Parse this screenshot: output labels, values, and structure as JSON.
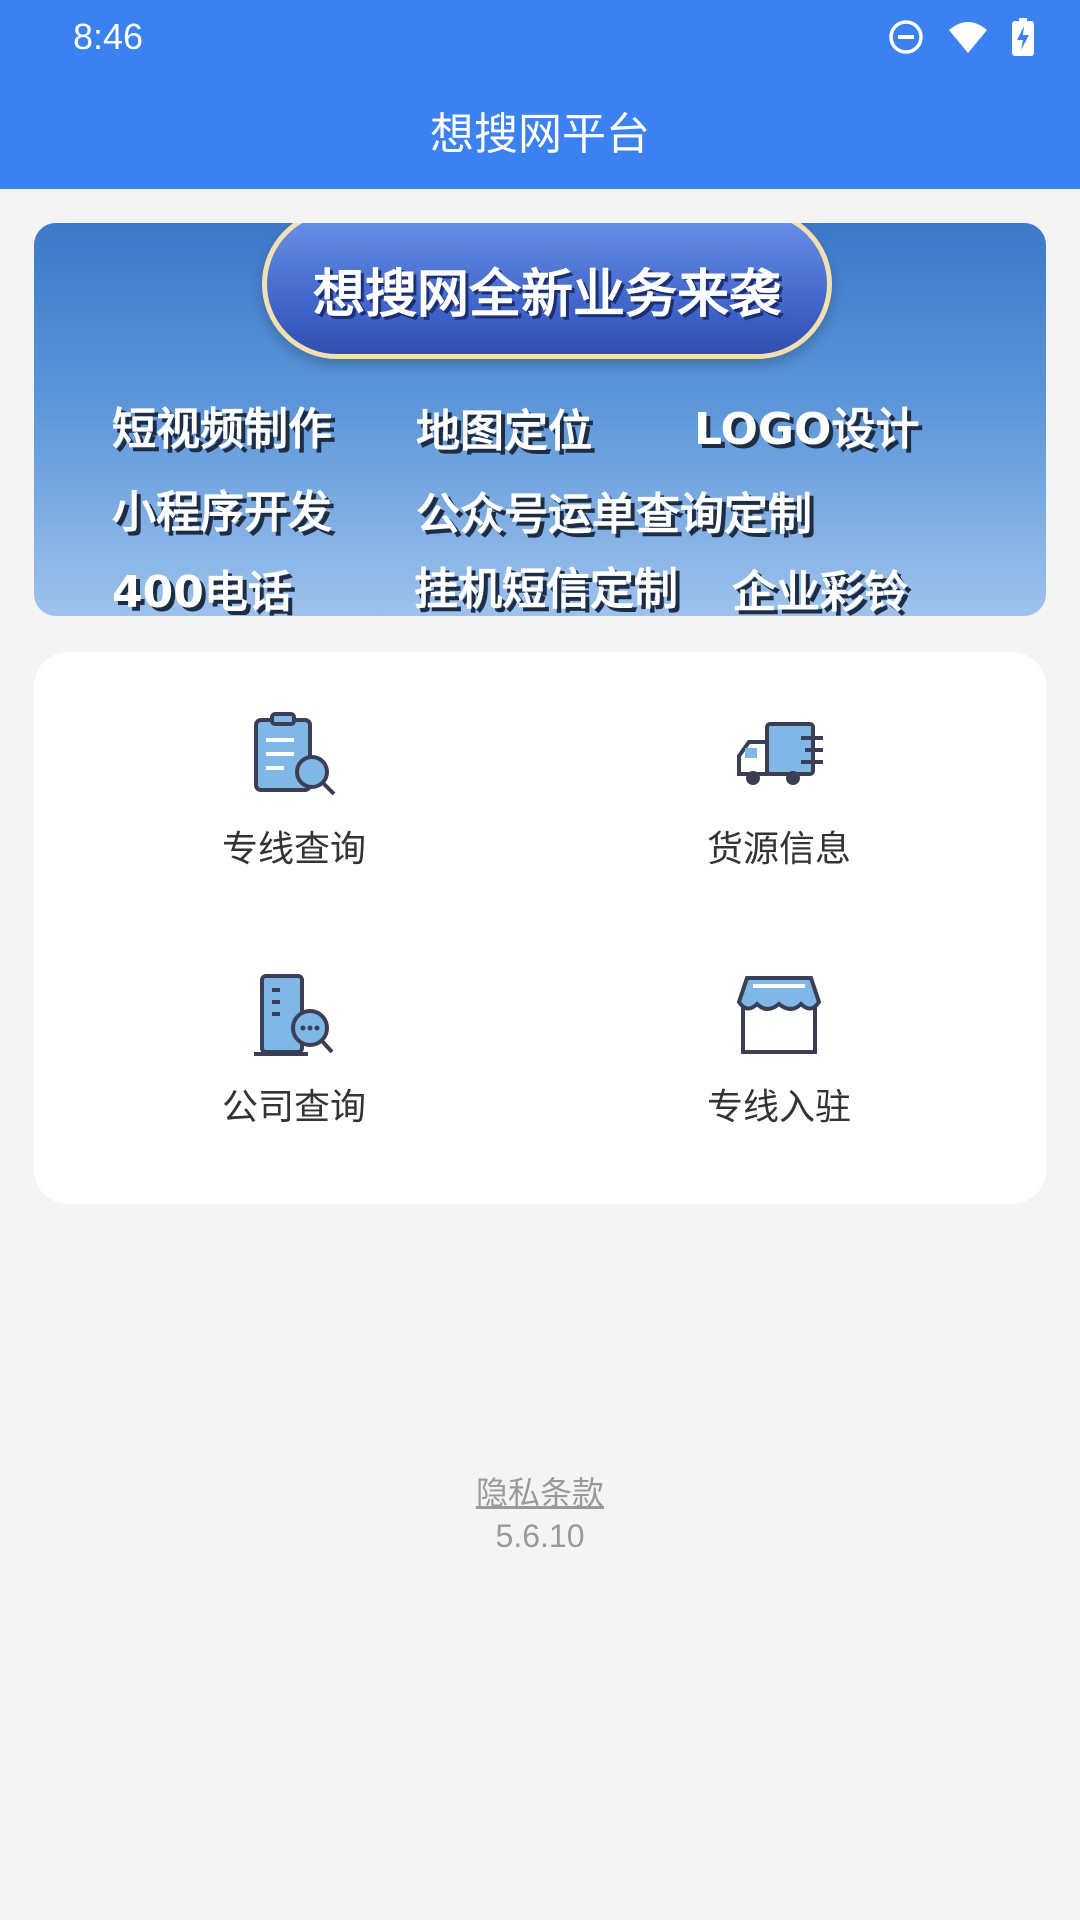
{
  "status_bar": {
    "time": "8:46",
    "icons": [
      "do-not-disturb-icon",
      "wifi-icon",
      "battery-charging-icon"
    ]
  },
  "header": {
    "title": "想搜网平台"
  },
  "banner": {
    "headline": "想搜网全新业务来袭",
    "services": [
      "短视频制作",
      "地图定位",
      "LOGO设计",
      "小程序开发",
      "公众号运单查询定制",
      "400电话",
      "挂机短信定制",
      "企业彩铃"
    ]
  },
  "menu": {
    "items": [
      {
        "label": "专线查询",
        "icon": "clipboard-search-icon"
      },
      {
        "label": "货源信息",
        "icon": "truck-icon"
      },
      {
        "label": "公司查询",
        "icon": "building-search-icon"
      },
      {
        "label": "专线入驻",
        "icon": "storefront-icon"
      }
    ]
  },
  "footer": {
    "privacy_label": "隐私条款",
    "version": "5.6.10"
  },
  "colors": {
    "primary": "#3b82f0",
    "icon_fill": "#7fb7e6",
    "icon_stroke": "#3a3f55"
  }
}
